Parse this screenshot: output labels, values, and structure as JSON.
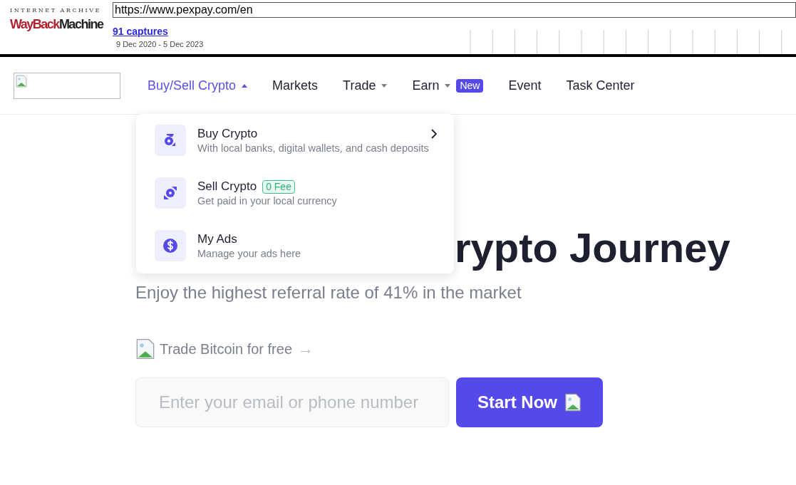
{
  "wayback": {
    "brand_top": "INTERNET ARCHIVE",
    "brand_left": "WayBack",
    "brand_right": "Machine",
    "url": "https://www.pexpay.com/en",
    "captures": "91 captures",
    "range": "9 Dec 2020 - 5 Dec 2023"
  },
  "nav": [
    {
      "label": "Buy/Sell Crypto",
      "selected": true,
      "kind": "dropdown",
      "expanded": true
    },
    {
      "label": "Markets",
      "selected": false,
      "kind": "link"
    },
    {
      "label": "Trade",
      "selected": false,
      "kind": "dropdown",
      "expanded": false
    },
    {
      "label": "Earn",
      "selected": false,
      "kind": "dropdown",
      "expanded": false,
      "badge": "New"
    },
    {
      "label": "Event",
      "selected": false,
      "kind": "link"
    },
    {
      "label": "Task Center",
      "selected": false,
      "kind": "link"
    }
  ],
  "menu": [
    {
      "title": "Buy Crypto",
      "subtitle": "With local banks, digital wallets, and cash deposits",
      "kind": "buy",
      "chevron": true
    },
    {
      "title": "Sell Crypto",
      "subtitle": "Get paid in your local currency",
      "kind": "sell",
      "tag": "0 Fee"
    },
    {
      "title": "My Ads",
      "subtitle": "Manage your ads here",
      "kind": "dollar"
    }
  ],
  "hero": {
    "title": "rypto Journey",
    "subtitle": "Enjoy the highest referral rate of 41% in the market",
    "link": "Trade Bitcoin for free",
    "arrow": "→",
    "email": {
      "placeholder": "Enter your email or phone number"
    },
    "button": "Start Now"
  }
}
